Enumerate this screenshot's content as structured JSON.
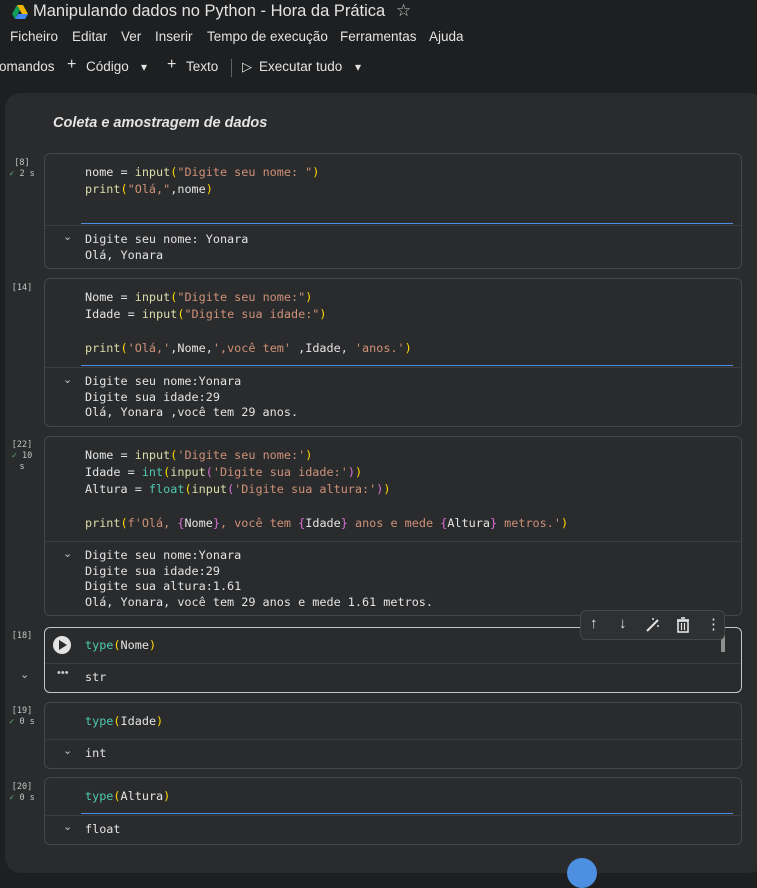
{
  "window": {
    "title": "Manipulando dados no Python - Hora da Prática"
  },
  "menu": [
    "Ficheiro",
    "Editar",
    "Ver",
    "Inserir",
    "Tempo de execução",
    "Ferramentas",
    "Ajuda"
  ],
  "toolbar": {
    "commands_label": "omandos",
    "code_label": "Código",
    "text_label": "Texto",
    "run_all_label": "Executar tudo"
  },
  "notebook": {
    "section_heading": "Coleta e amostragem de dados",
    "cells": [
      {
        "exec_count": "[8]",
        "duration": "2 s",
        "code_lines": [
          "nome = input(\"Digite seu nome: \")",
          "print(\"Olá,\",nome)"
        ],
        "output_lines": [
          "Digite seu nome: Yonara",
          "Olá, Yonara"
        ]
      },
      {
        "exec_count": "[14]",
        "duration": "",
        "code_lines": [
          "Nome = input(\"Digite seu nome:\")",
          "Idade = input(\"Digite sua idade:\")",
          "",
          "print('Olá,',Nome,',você tem' ,Idade, 'anos.')"
        ],
        "output_lines": [
          "Digite seu nome:Yonara",
          "Digite sua idade:29",
          "Olá, Yonara ,você tem 29 anos."
        ]
      },
      {
        "exec_count": "[22]",
        "duration": "10 s",
        "code_lines": [
          "Nome = input('Digite seu nome:')",
          "Idade = int(input('Digite sua idade:'))",
          "Altura = float(input('Digite sua altura:'))",
          "",
          "print(f'Olá, {Nome}, você tem {Idade} anos e mede {Altura} metros.')"
        ],
        "output_lines": [
          "Digite seu nome:Yonara",
          "Digite sua idade:29",
          "Digite sua altura:1.61",
          "Olá, Yonara, você tem 29 anos e mede 1.61 metros."
        ]
      },
      {
        "exec_count": "[18]",
        "duration": "",
        "code_lines": [
          "type(Nome)"
        ],
        "output_lines": [
          "str"
        ]
      },
      {
        "exec_count": "[19]",
        "duration": "0 s",
        "code_lines": [
          "type(Idade)"
        ],
        "output_lines": [
          "int"
        ]
      },
      {
        "exec_count": "[20]",
        "duration": "0 s",
        "code_lines": [
          "type(Altura)"
        ],
        "output_lines": [
          "float"
        ]
      }
    ]
  },
  "icons": {
    "check": "✓",
    "chevron": "⌄",
    "star": "☆",
    "plus": "+",
    "play": "▷",
    "dropdown": "▾",
    "more": "•••",
    "arrow_up": "↑",
    "arrow_down": "↓",
    "delete": "🗑",
    "kebab": "⋮"
  },
  "colors": {
    "accent": "#4d8fe0",
    "success": "#5bb974",
    "function": "#dcdcaa",
    "string": "#ce9178",
    "builtin_type": "#4ec9b0"
  }
}
